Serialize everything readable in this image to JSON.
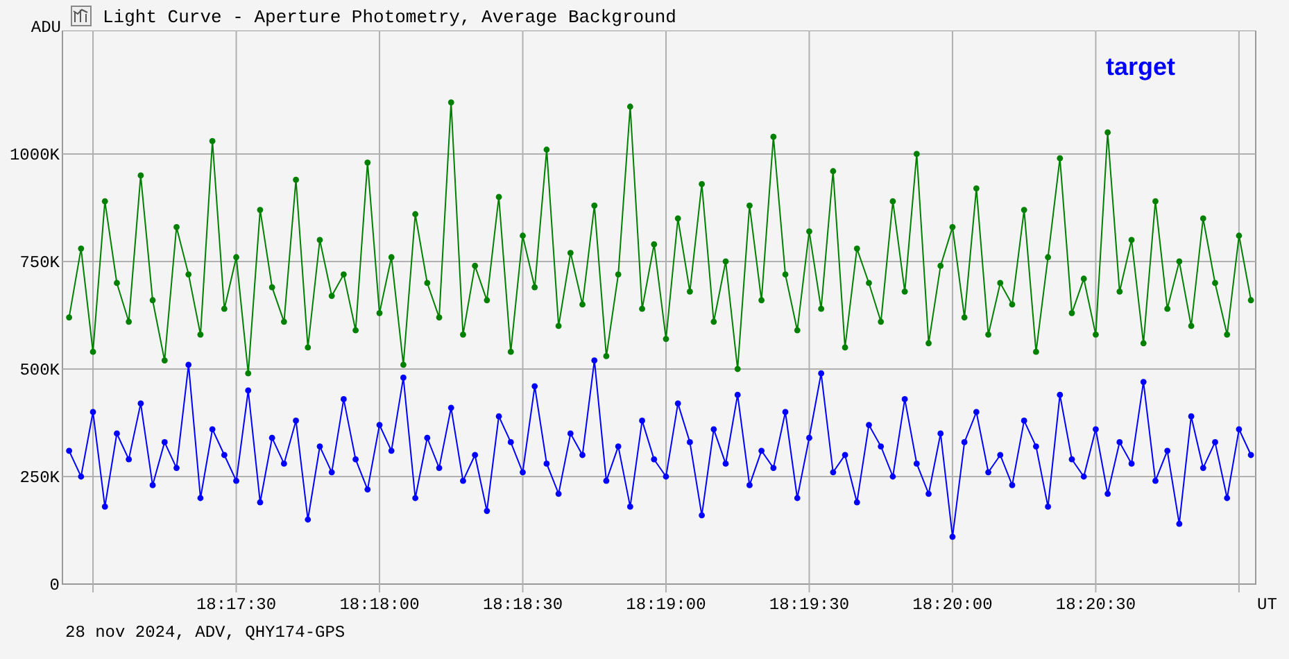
{
  "window": {
    "title": "Light Curve - Aperture Photometry, Average Background"
  },
  "chart_data": {
    "type": "line",
    "ylabel": "ADU",
    "xlabel": "UT",
    "xlim": [
      65813.6,
      66063.5
    ],
    "ylim": [
      0,
      1287
    ],
    "grid": true,
    "x": [
      65815,
      65817.5,
      65820,
      65822.5,
      65825,
      65827.5,
      65830,
      65832.5,
      65835,
      65837.5,
      65840,
      65842.5,
      65845,
      65847.5,
      65850,
      65852.5,
      65855,
      65857.5,
      65860,
      65862.5,
      65865,
      65867.5,
      65870,
      65872.5,
      65875,
      65877.5,
      65880,
      65882.5,
      65885,
      65887.5,
      65890,
      65892.5,
      65895,
      65897.5,
      65900,
      65902.5,
      65905,
      65907.5,
      65910,
      65912.5,
      65915,
      65917.5,
      65920,
      65922.5,
      65925,
      65927.5,
      65930,
      65932.5,
      65935,
      65937.5,
      65940,
      65942.5,
      65945,
      65947.5,
      65950,
      65952.5,
      65955,
      65957.5,
      65960,
      65962.5,
      65965,
      65967.5,
      65970,
      65972.5,
      65975,
      65977.5,
      65980,
      65982.5,
      65985,
      65987.5,
      65990,
      65992.5,
      65995,
      65997.5,
      66000,
      66002.5,
      66005,
      66007.5,
      66010,
      66012.5,
      66015,
      66017.5,
      66020,
      66022.5,
      66025,
      66027.5,
      66030,
      66032.5,
      66035,
      66037.5,
      66040,
      66042.5,
      66045,
      66047.5,
      66050,
      66052.5,
      66055,
      66057.5,
      66060,
      66062.5
    ],
    "xticks": [
      {
        "value": 65850,
        "label": "18:17:30"
      },
      {
        "value": 65880,
        "label": "18:18:00"
      },
      {
        "value": 65910,
        "label": "18:18:30"
      },
      {
        "value": 65940,
        "label": "18:19:00"
      },
      {
        "value": 65970,
        "label": "18:19:30"
      },
      {
        "value": 66000,
        "label": "18:20:00"
      },
      {
        "value": 66030,
        "label": "18:20:30"
      }
    ],
    "yticks": [
      {
        "value": 1000,
        "label": "1000K"
      },
      {
        "value": 750,
        "label": "750K"
      },
      {
        "value": 500,
        "label": "500K"
      },
      {
        "value": 250,
        "label": "250K"
      },
      {
        "value": 0,
        "label": "0"
      }
    ],
    "series": [
      {
        "color": "#008000",
        "marker": "circle",
        "values": [
          620,
          780,
          540,
          890,
          700,
          610,
          950,
          660,
          520,
          830,
          720,
          580,
          1030,
          640,
          760,
          490,
          870,
          690,
          610,
          940,
          550,
          800,
          670,
          720,
          590,
          980,
          630,
          760,
          510,
          860,
          700,
          620,
          1120,
          580,
          740,
          660,
          900,
          540,
          810,
          690,
          1010,
          600,
          770,
          650,
          880,
          530,
          720,
          1110,
          640,
          790,
          570,
          850,
          680,
          930,
          610,
          750,
          500,
          880,
          660,
          1040,
          720,
          590,
          820,
          640,
          960,
          550,
          780,
          700,
          610,
          890,
          680,
          1000,
          560,
          740,
          830,
          620,
          920,
          580,
          700,
          650,
          870,
          540,
          760,
          990,
          630,
          710,
          580,
          1050,
          680,
          800,
          560,
          890,
          640,
          750,
          600,
          850,
          700,
          580,
          810,
          660
        ]
      },
      {
        "color": "#0000ff",
        "marker": "circle",
        "values": [
          310,
          250,
          400,
          180,
          350,
          290,
          420,
          230,
          330,
          270,
          510,
          200,
          360,
          300,
          240,
          450,
          190,
          340,
          280,
          380,
          150,
          320,
          260,
          430,
          290,
          220,
          370,
          310,
          480,
          200,
          340,
          270,
          410,
          240,
          300,
          170,
          390,
          330,
          260,
          460,
          280,
          210,
          350,
          300,
          520,
          240,
          320,
          180,
          380,
          290,
          250,
          420,
          330,
          160,
          360,
          280,
          440,
          230,
          310,
          270,
          400,
          200,
          340,
          490,
          260,
          300,
          190,
          370,
          320,
          250,
          430,
          280,
          210,
          350,
          110,
          330,
          400,
          260,
          300,
          230,
          380,
          320,
          180,
          440,
          290,
          250,
          360,
          210,
          330,
          280,
          470,
          240,
          310,
          140,
          390,
          270,
          330,
          200,
          360,
          300
        ]
      }
    ]
  },
  "legend": {
    "label": "target",
    "color": "#0000ff"
  },
  "footer": "28 nov 2024, ADV, QHY174-GPS"
}
